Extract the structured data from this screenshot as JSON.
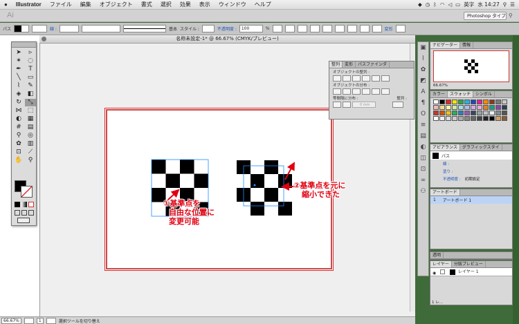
{
  "menubar": {
    "app_name": "Illustrator",
    "items": [
      "ファイル",
      "編集",
      "オブジェクト",
      "書式",
      "選択",
      "効果",
      "表示",
      "ウィンドウ",
      "ヘルプ"
    ],
    "ime": "英字",
    "clock": "水 14:27"
  },
  "appbar": {
    "logo": "Ai",
    "workspace": "Photoshop タイプ ▾"
  },
  "controlbar": {
    "path_label": "パス",
    "stroke_label": "線 :",
    "stroke_style": "基本",
    "style_label": "スタイル :",
    "opacity_label": "不透明度 :",
    "opacity_value": "100",
    "opacity_unit": "%",
    "transform_label": "変形"
  },
  "document": {
    "title": "名称未設定-1* @ 66.67% (CMYK/プレビュー)"
  },
  "statusbar": {
    "zoom": "66.67%",
    "artboard_num": "1",
    "status_text": "選択ツールを切り替え"
  },
  "align_panel": {
    "tabs": [
      "整列",
      "変形",
      "パスファインダ"
    ],
    "sec_align": "オブジェクトの整列 :",
    "sec_distribute": "オブジェクトの分布 :",
    "sec_spacing": "等間隔に分布 :",
    "sec_align_to": "整列 :",
    "spacing_value": "0 mm"
  },
  "navigator": {
    "tabs": [
      "ナビゲーター",
      "情報"
    ],
    "zoom": "66.67%"
  },
  "swatch_panel": {
    "tabs": [
      "カラー",
      "スウォッチ",
      "シンボル"
    ]
  },
  "appearance_panel": {
    "tabs": [
      "アピアランス",
      "グラフィックスタイ"
    ],
    "object_label": "パス",
    "stroke_row": "線 :",
    "fill_row": "塗り :",
    "opacity_row": "不透明度 :",
    "opacity_value": "初期設定"
  },
  "artboard_panel": {
    "tab": "アートボード",
    "row_num": "1",
    "row_name": "アートボード 1"
  },
  "transparency_panel": {
    "tab": "透明"
  },
  "layers_panel": {
    "tabs": [
      "レイヤー",
      "分版プレビュー"
    ],
    "layer_name": "レイヤー 1",
    "count_text": "1 レ..."
  },
  "annotations": {
    "left_num": "①",
    "left_line1": "基準点を",
    "left_line2": "自由な位置に",
    "left_line3": "変更可能",
    "right_num": "②",
    "right_line1": "基準点を元に",
    "right_line2": "縮小できた"
  },
  "colors": {
    "annotation_red": "#e00010",
    "artboard_border": "#e02a2a",
    "selection_blue": "#1e8bff",
    "checker": "#000000"
  }
}
